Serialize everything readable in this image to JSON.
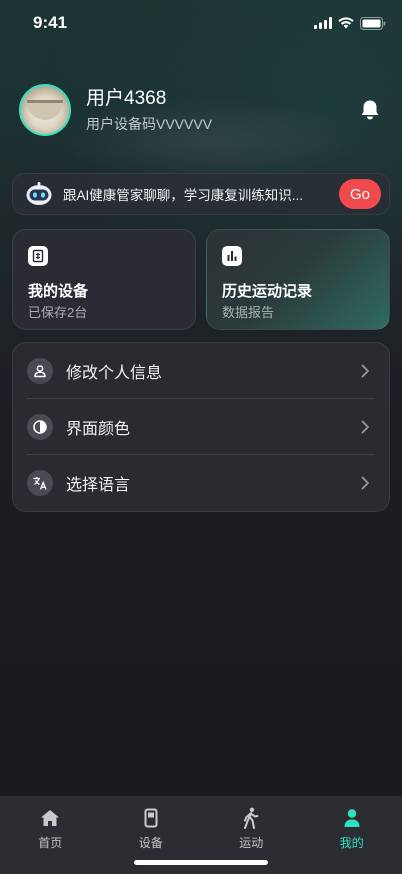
{
  "status_bar": {
    "time": "9:41"
  },
  "profile": {
    "username": "用户4368",
    "device_code": "用户设备码VVVVVV"
  },
  "ai_banner": {
    "text": "跟AI健康管家聊聊，学习康复训练知识...",
    "go_label": "Go"
  },
  "cards": [
    {
      "title": "我的设备",
      "subtitle": "已保存2台",
      "icon": "device-icon"
    },
    {
      "title": "历史运动记录",
      "subtitle": "数据报告",
      "icon": "bar-chart-icon"
    }
  ],
  "settings": [
    {
      "label": "修改个人信息",
      "icon": "person-icon"
    },
    {
      "label": "界面颜色",
      "icon": "contrast-icon"
    },
    {
      "label": "选择语言",
      "icon": "translate-icon"
    }
  ],
  "tabbar": [
    {
      "label": "首页",
      "icon": "home-icon"
    },
    {
      "label": "设备",
      "icon": "device-icon"
    },
    {
      "label": "运动",
      "icon": "walk-icon"
    },
    {
      "label": "我的",
      "icon": "person-icon",
      "active": true
    }
  ],
  "colors": {
    "accent": "#2fe2c2",
    "go_button": "#f04a4e",
    "avatar_ring": "#35e0c0"
  }
}
